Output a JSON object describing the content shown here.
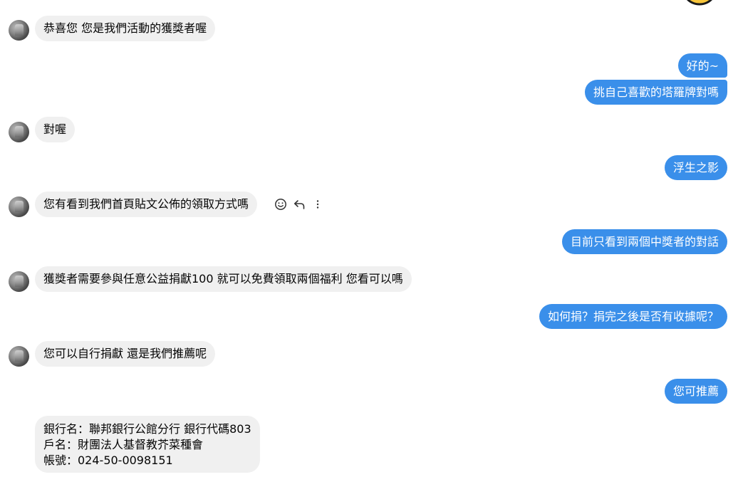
{
  "incoming": [
    {
      "text": "恭喜您 您是我們活動的獲獎者喔"
    },
    {
      "text": "對喔"
    },
    {
      "text": "您有看到我們首頁貼文公佈的領取方式嗎"
    },
    {
      "text": "獲獎者需要參與任意公益捐獻100 就可以免費領取兩個福利 您看可以嗎"
    },
    {
      "text": "您可以自行捐獻 還是我們推薦呢"
    }
  ],
  "bank_message": {
    "lines": [
      "銀行名：聯邦銀行公館分行 銀行代碼803",
      "戶名：財團法人基督教芥菜種會",
      "帳號：024-50-0098151"
    ]
  },
  "outgoing": [
    {
      "text": "好的~"
    },
    {
      "text": "挑自己喜歡的塔羅牌對嗎"
    },
    {
      "text": "浮生之影"
    },
    {
      "text": "目前只看到兩個中獎者的對話"
    },
    {
      "text": "如何捐？捐完之後是否有收據呢？"
    },
    {
      "text": "您可推薦"
    }
  ],
  "message_actions": {
    "icons": [
      "smiley-icon",
      "reply-icon",
      "more-vertical-icon"
    ]
  },
  "colors": {
    "outgoing_bubble": "#3a8fea",
    "incoming_bubble": "#f0f0f0",
    "emoji_yellow": "#f7c53a"
  }
}
